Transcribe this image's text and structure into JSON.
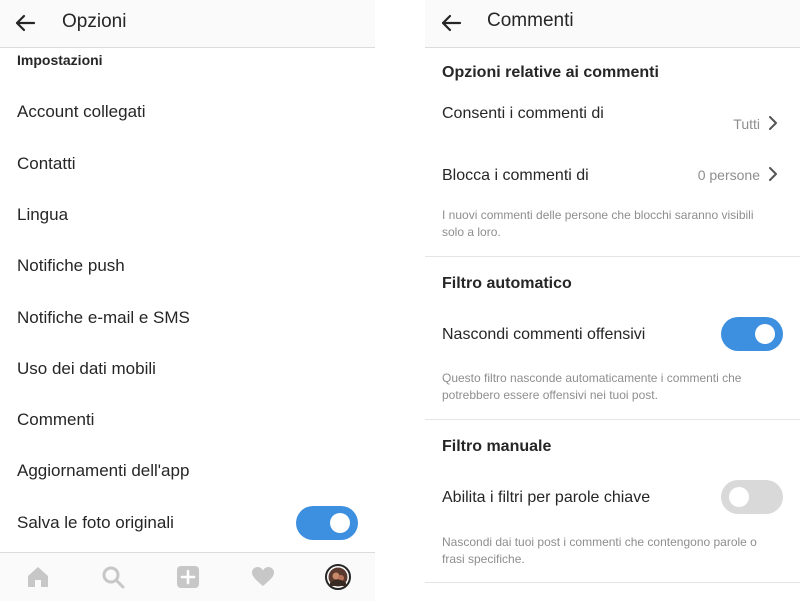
{
  "left": {
    "title": "Opzioni",
    "section": "Impostazioni",
    "items": [
      {
        "label": "Account collegati"
      },
      {
        "label": "Contatti"
      },
      {
        "label": "Lingua"
      },
      {
        "label": "Notifiche push"
      },
      {
        "label": "Notifiche e-mail e SMS"
      },
      {
        "label": "Uso dei dati mobili"
      },
      {
        "label": "Commenti"
      },
      {
        "label": "Aggiornamenti dell'app"
      },
      {
        "label": "Salva le foto originali",
        "toggle": true
      }
    ],
    "tabbar": [
      "home-icon",
      "search-icon",
      "add-icon",
      "heart-icon",
      "profile-avatar"
    ]
  },
  "right": {
    "title": "Commenti",
    "comment_options": {
      "heading": "Opzioni relative ai commenti",
      "allow_label": "Consenti i commenti di",
      "allow_value": "Tutti",
      "block_label": "Blocca i commenti di",
      "block_value": "0 persone",
      "note": "I nuovi commenti delle persone che blocchi saranno visibili solo a loro."
    },
    "auto_filter": {
      "heading": "Filtro automatico",
      "label": "Nascondi commenti offensivi",
      "enabled": true,
      "note": "Questo filtro nasconde automaticamente i commenti che potrebbero essere offensivi nei tuoi post."
    },
    "manual_filter": {
      "heading": "Filtro manuale",
      "label": "Abilita i filtri per parole chiave",
      "enabled": false,
      "note": "Nascondi dai tuoi post i commenti che contengono parole o frasi specifiche."
    }
  },
  "colors": {
    "toggle_on": "#3d8fe0",
    "toggle_off": "#d9d9d9",
    "muted_text": "#8e8e8e"
  }
}
